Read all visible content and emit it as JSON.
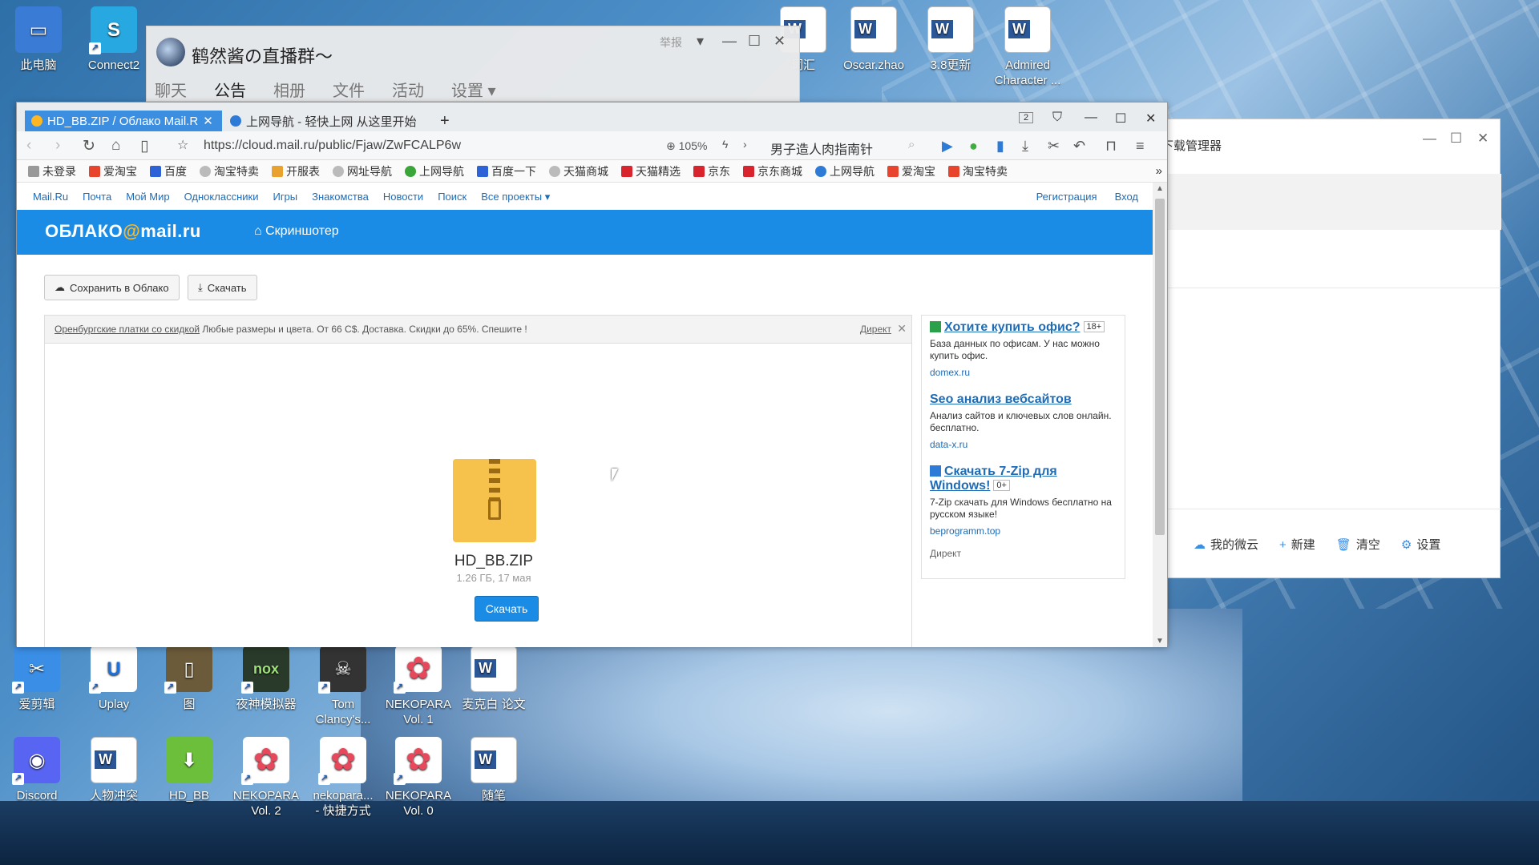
{
  "desktop": {
    "icons": [
      {
        "label": "此电脑",
        "color": "#3a7bd5",
        "glyph": "▭",
        "shortcut": false
      },
      {
        "label": "Connect2",
        "color": "#27a8e0",
        "glyph": "S",
        "shortcut": true
      },
      {
        "label": "Oscar.zhao",
        "color": "#ffffff",
        "glyph": "W",
        "shortcut": false
      },
      {
        "label": "3.8更新",
        "color": "#ffffff",
        "glyph": "W",
        "shortcut": false
      },
      {
        "label": "Admired Character ...",
        "color": "#ffffff",
        "glyph": "W",
        "shortcut": false
      },
      {
        "label": "爱剪辑",
        "color": "#3a8ee6",
        "glyph": "✂",
        "shortcut": true
      },
      {
        "label": "Uplay",
        "color": "#ffffff",
        "glyph": "U",
        "shortcut": true
      },
      {
        "label": "图",
        "color": "#6b5b3a",
        "glyph": "▯",
        "shortcut": true
      },
      {
        "label": "夜神模拟器",
        "color": "#2a3a2a",
        "glyph": "nox",
        "shortcut": true
      },
      {
        "label": "Tom Clancy's...",
        "color": "#333333",
        "glyph": "☠",
        "shortcut": true
      },
      {
        "label": "NEKOPARA Vol. 1",
        "color": "#ffffff",
        "glyph": "🐾",
        "shortcut": true
      },
      {
        "label": "麦克白 论文",
        "color": "#ffffff",
        "glyph": "W",
        "shortcut": false
      },
      {
        "label": "Discord",
        "color": "#5865f2",
        "glyph": "◉",
        "shortcut": true
      },
      {
        "label": "人物冲突",
        "color": "#ffffff",
        "glyph": "W",
        "shortcut": false
      },
      {
        "label": "HD_BB",
        "color": "#6bbf3a",
        "glyph": "⬇",
        "shortcut": false
      },
      {
        "label": "NEKOPARA Vol. 2",
        "color": "#ffffff",
        "glyph": "🐾",
        "shortcut": true
      },
      {
        "label": "nekopara... - 快捷方式",
        "color": "#ffffff",
        "glyph": "🐾",
        "shortcut": true
      },
      {
        "label": "NEKOPARA Vol. 0",
        "color": "#ffffff",
        "glyph": "🐾",
        "shortcut": true
      },
      {
        "label": "随笔",
        "color": "#ffffff",
        "glyph": "W",
        "shortcut": false
      },
      {
        "label": "词汇",
        "color": "#ffffff",
        "glyph": "W",
        "shortcut": false
      }
    ]
  },
  "qq_window": {
    "title": "鹤然酱の直播群～",
    "report": "举报",
    "tabs": [
      "聊天",
      "公告",
      "相册",
      "文件",
      "活动",
      "设置 ▾"
    ]
  },
  "download_manager": {
    "title": "下载管理器",
    "actions": [
      {
        "icon": "☁",
        "label": "我的微云"
      },
      {
        "icon": "+",
        "label": "新建"
      },
      {
        "icon": "🗑",
        "label": "清空"
      },
      {
        "icon": "⚙",
        "label": "设置"
      }
    ]
  },
  "browser": {
    "tabs": [
      {
        "label": "HD_BB.ZIP / Облако Mail.R",
        "active": true
      },
      {
        "label": "上网导航 - 轻快上网 从这里开始",
        "active": false
      }
    ],
    "new_tab": "+",
    "tab_count": "2",
    "url": "https://cloud.mail.ru/public/Fjaw/ZwFCALP6w",
    "zoom": "105%",
    "search_text": "男子造人肉指南针",
    "bookmarks": [
      {
        "label": "未登录",
        "color": "#999999"
      },
      {
        "label": "爱淘宝",
        "color": "#e8442d"
      },
      {
        "label": "百度",
        "color": "#2d63d6"
      },
      {
        "label": "淘宝特卖",
        "color": "#888888"
      },
      {
        "label": "开服表",
        "color": "#e8a22d"
      },
      {
        "label": "网址导航",
        "color": "#888888"
      },
      {
        "label": "上网导航",
        "color": "#3aa63a"
      },
      {
        "label": "百度一下",
        "color": "#2d63d6"
      },
      {
        "label": "天猫商城",
        "color": "#888888"
      },
      {
        "label": "天猫精选",
        "color": "#d8252d"
      },
      {
        "label": "京东",
        "color": "#d8252d"
      },
      {
        "label": "京东商城",
        "color": "#d8252d"
      },
      {
        "label": "上网导航",
        "color": "#2d7bd6"
      },
      {
        "label": "爱淘宝",
        "color": "#e8442d"
      },
      {
        "label": "淘宝特卖",
        "color": "#e8442d"
      }
    ],
    "bookmarks_more": "»"
  },
  "page": {
    "top_links": [
      "Mail.Ru",
      "Почта",
      "Мой Мир",
      "Одноклассники",
      "Игры",
      "Знакомства",
      "Новости",
      "Поиск",
      "Все проекты ▾"
    ],
    "top_right": [
      "Регистрация",
      "Вход"
    ],
    "logo_left": "ОБЛАКО",
    "logo_at": "@",
    "logo_right": "mail.ru",
    "screenshoter": "Скриншотер",
    "save_button": "Сохранить в Облако",
    "download_button": "Скачать",
    "adbar": {
      "link": "Оренбургские платки со скидкой",
      "text": " Любые размеры и цвета. От 66 С$. Доставка. Скидки до 65%. Спешите !",
      "direct": "Директ",
      "close": "✕"
    },
    "file": {
      "name": "HD_BB.ZIP",
      "meta": "1.26 ГБ, 17 мая",
      "download": "Скачать"
    },
    "side_ads": [
      {
        "title": "Хотите купить офис?",
        "age": "18+",
        "desc": "База данных по офисам. У нас можно купить офис.",
        "url": "domex.ru"
      },
      {
        "title": "Seo анализ вебсайтов",
        "age": "",
        "desc": "Анализ сайтов и ключевых слов онлайн. бесплатно.",
        "url": "data-x.ru"
      },
      {
        "title": "Скачать 7-Zip для Windows!",
        "age": "0+",
        "desc": "7-Zip скачать для Windows бесплатно на русском языке!",
        "url": "beprogramm.top"
      }
    ],
    "side_direct": "Директ"
  }
}
